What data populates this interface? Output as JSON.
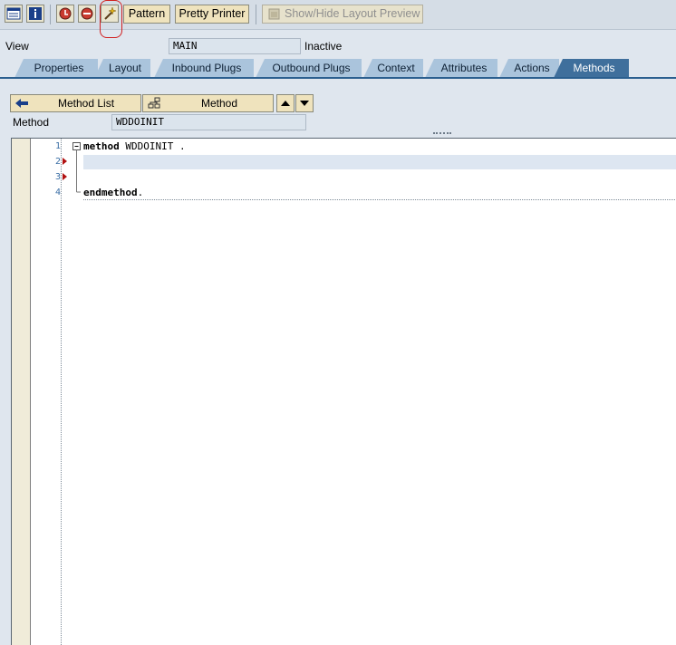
{
  "toolbar": {
    "icons": [
      "display-object-list-icon",
      "info-icon",
      "activate-icon",
      "delete-icon",
      "code-wizard-icon"
    ],
    "pattern_label": "Pattern",
    "pretty_printer_label": "Pretty Printer",
    "layout_preview_label": "Show/Hide Layout Preview"
  },
  "header": {
    "view_label": "View",
    "view_value": "MAIN",
    "status": "Inactive"
  },
  "tabs": [
    {
      "label": "Properties"
    },
    {
      "label": "Layout"
    },
    {
      "label": "Inbound Plugs"
    },
    {
      "label": "Outbound Plugs"
    },
    {
      "label": "Context"
    },
    {
      "label": "Attributes"
    },
    {
      "label": "Actions"
    },
    {
      "label": "Methods",
      "active": true
    }
  ],
  "method_panel": {
    "method_list_label": "Method List",
    "method_label": "Method",
    "field_label": "Method",
    "field_value": "WDDOINIT"
  },
  "editor": {
    "line_numbers": [
      "1",
      "2",
      "3",
      "4"
    ],
    "line1_kw": "method",
    "line1_rest": " WDDOINIT .",
    "line4_kw": "endmethod",
    "line4_rest": "."
  },
  "colors": {
    "active_tab": "#3f6f9c",
    "tab": "#aac4dc",
    "button": "#efe3bd",
    "highlight": "#d12020"
  }
}
